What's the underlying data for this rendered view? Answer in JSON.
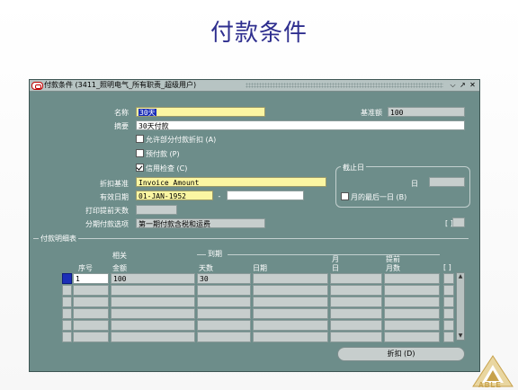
{
  "slide": {
    "title": "付款条件"
  },
  "window": {
    "title": "付款条件 (3411_照明电气_所有职责_超级用户)",
    "controls": [
      "⌵",
      "↗",
      "✕"
    ]
  },
  "form": {
    "name_label": "名称",
    "name_value": "30天",
    "base_amount_label": "基准额",
    "base_amount_value": "100",
    "description_label": "摘要",
    "description_value": "30天付款",
    "allow_partial_discount": {
      "label": "允许部分付款折扣 (A)",
      "checked": false
    },
    "prepayment": {
      "label": "预付款 (P)",
      "checked": false
    },
    "credit_check": {
      "label": "信用检查 (C)",
      "checked": true
    },
    "discount_basis_label": "折扣基准",
    "discount_basis_value": "Invoice Amount",
    "effective_dates_label": "有效日期",
    "effective_from": "01-JAN-1952",
    "date_separator": "-",
    "effective_to": "",
    "print_lead_days_label": "打印提前天数",
    "print_lead_days_value": "",
    "installment_options_label": "分期付款选项",
    "installment_options_value": "第一期付款含税和运费",
    "bracket_label": "[ ]"
  },
  "cutoff_group": {
    "title": "截止日",
    "day_label": "日",
    "day_value": "",
    "last_day_of_month": {
      "label": "月的最后一日 (B)",
      "checked": false
    }
  },
  "schedule": {
    "section_title": "付款明细表",
    "headers": {
      "seq": "序号",
      "relative_amount_top": "相关",
      "relative_amount_bottom": "金额",
      "due_group": "到期",
      "days": "天数",
      "date": "日期",
      "month_top": "月",
      "month_bottom": "日",
      "advance_top": "提前",
      "advance_bottom": "月数",
      "bracket": "[ ]"
    },
    "rows": [
      {
        "seq": "1",
        "amount": "100",
        "days": "30",
        "date": "",
        "day_of_month": "",
        "months_ahead": ""
      },
      {
        "seq": "",
        "amount": "",
        "days": "",
        "date": "",
        "day_of_month": "",
        "months_ahead": ""
      },
      {
        "seq": "",
        "amount": "",
        "days": "",
        "date": "",
        "day_of_month": "",
        "months_ahead": ""
      },
      {
        "seq": "",
        "amount": "",
        "days": "",
        "date": "",
        "day_of_month": "",
        "months_ahead": ""
      },
      {
        "seq": "",
        "amount": "",
        "days": "",
        "date": "",
        "day_of_month": "",
        "months_ahead": ""
      },
      {
        "seq": "",
        "amount": "",
        "days": "",
        "date": "",
        "day_of_month": "",
        "months_ahead": ""
      }
    ]
  },
  "buttons": {
    "discount": "折扣 (D)"
  },
  "logo": {
    "text": "ABLE"
  },
  "colors": {
    "window_bg": "#6d8d8a",
    "required_field": "#fbf6a2",
    "selection": "#1c2fb8"
  }
}
